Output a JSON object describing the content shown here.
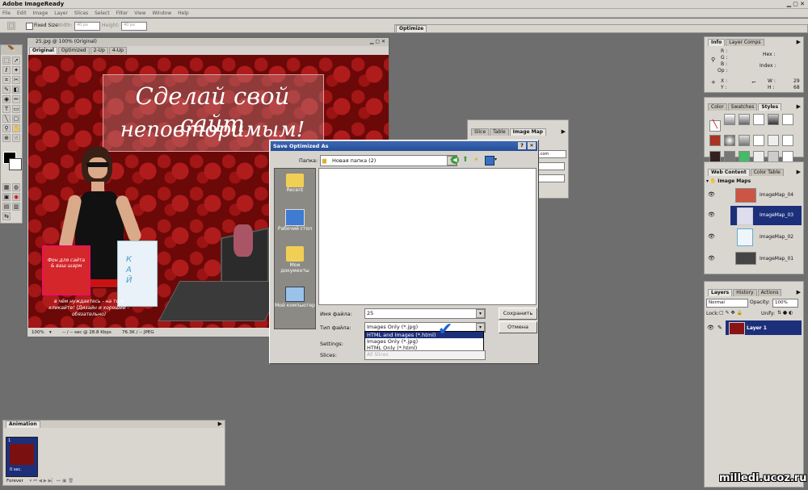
{
  "app": {
    "title": "Adobe ImageReady",
    "menu": [
      "File",
      "Edit",
      "Image",
      "Layer",
      "Slices",
      "Select",
      "Filter",
      "View",
      "Window",
      "Help"
    ],
    "options": {
      "fixed_size": "Fixed Size",
      "width_label": "Width:",
      "width_value": "40 px",
      "height_label": "Height:",
      "height_value": "40 px"
    },
    "optimize_tab": "Optimize"
  },
  "document": {
    "title": "25.jpg @ 100% (Original)",
    "tabs": [
      "Original",
      "Optimized",
      "2-Up",
      "4-Up"
    ],
    "headline_1": "Сделай свой сайт",
    "headline_2": "неповторимым!",
    "bag_text": "Фон для сайта & ваш шарм",
    "bottom_text": "в чём нуждаетесь - на то и кликайте! (Дизайн и хороший - обязательно)",
    "status": {
      "zoom": "100%",
      "speed": "-- / -- sec @ 28.8 Kbps",
      "size": "76.3K / -- JPEG"
    }
  },
  "imagemap_panel": {
    "tabs": [
      "Slice",
      "Table",
      "Image Map"
    ],
    "url_fragment": "ot.com"
  },
  "dialog": {
    "title": "Save Optimized As",
    "folder_label": "Папка:",
    "folder_value": "Новая папка (2)",
    "places": [
      "Recent",
      "Рабочий стол",
      "Мои документы",
      "Мой компьютер"
    ],
    "filename_label": "Имя файла:",
    "filename_value": "25",
    "type_label": "Тип файла:",
    "type_value": "Images Only (*.jpg)",
    "type_options": [
      "HTML and Images (*.html)",
      "Images Only (*.jpg)",
      "HTML Only (*.html)"
    ],
    "settings_label": "Settings:",
    "slices_label": "Slices:",
    "slices_value": "All Slices",
    "save_button": "Сохранить",
    "cancel_button": "Отмена",
    "checkmark_color": "#1c63d6"
  },
  "info_panel": {
    "tabs": [
      "Info",
      "Layer Comps"
    ],
    "r": "R :",
    "g": "G :",
    "b": "B :",
    "op": "Op :",
    "hex": "Hex :",
    "index": "Index :",
    "x": "X :",
    "y": "Y :",
    "w": "W :",
    "h": "H :",
    "w_val": "29",
    "h_val": "68"
  },
  "styles_panel": {
    "tabs": [
      "Color",
      "Swatches",
      "Styles"
    ]
  },
  "webcontent_panel": {
    "tabs": [
      "Web Content",
      "Color Table"
    ],
    "group": "Image Maps",
    "items": [
      "ImageMap_04",
      "ImageMap_03",
      "ImageMap_02",
      "ImageMap_01"
    ],
    "selected_index": 1
  },
  "layers_panel": {
    "tabs": [
      "Layers",
      "History",
      "Actions"
    ],
    "blend": "Normal",
    "opacity_label": "Opacity:",
    "opacity_value": "100%",
    "lock_label": "Lock:",
    "unify_label": "Unify:",
    "layer_name": "Layer 1"
  },
  "animation_panel": {
    "title": "Animation",
    "frame_number": "1",
    "frame_delay": "0 sec.",
    "loop": "Forever"
  },
  "watermark": "milledi.ucoz.ru"
}
